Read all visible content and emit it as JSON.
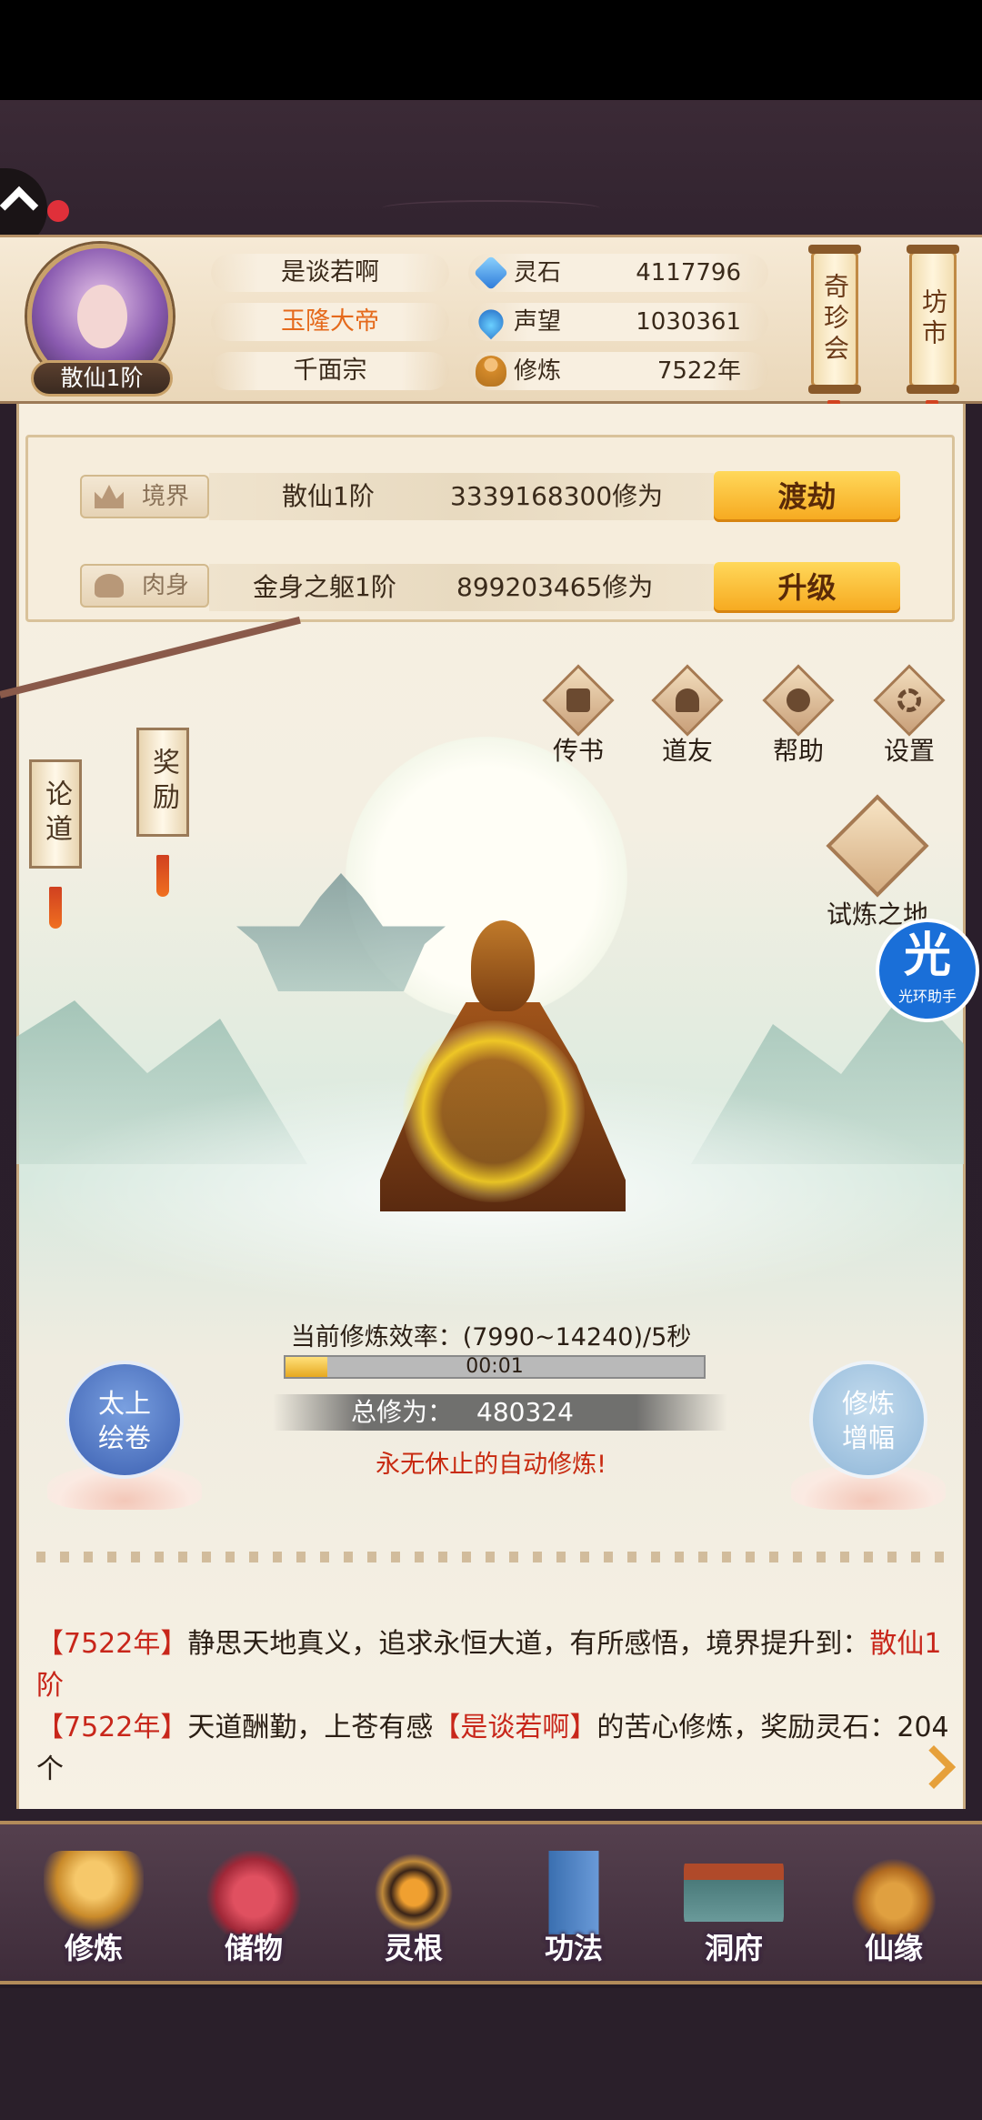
{
  "player": {
    "name": "是谈若啊",
    "title": "玉隆大帝",
    "sect": "千面宗",
    "rank": "散仙1阶"
  },
  "resources": [
    {
      "icon": "spirit-stone-icon",
      "label": "灵石",
      "value": "4117796"
    },
    {
      "icon": "reputation-icon",
      "label": "声望",
      "value": "1030361"
    },
    {
      "icon": "cultivation-icon",
      "label": "修炼",
      "value": "7522年"
    }
  ],
  "top_buttons": {
    "treasure": "奇珍会",
    "market": "坊市"
  },
  "realm": {
    "label": "境界",
    "stage": "散仙1阶",
    "required": "3339168300修为",
    "action": "渡劫"
  },
  "body": {
    "label": "肉身",
    "stage": "金身之躯1阶",
    "required": "899203465修为",
    "action": "升级"
  },
  "side_scrolls": {
    "discuss": "论道",
    "reward": "奖励"
  },
  "quick_icons": [
    {
      "icon": "mail-icon",
      "label": "传书"
    },
    {
      "icon": "friend-icon",
      "label": "道友"
    },
    {
      "icon": "help-icon",
      "label": "帮助"
    },
    {
      "icon": "settings-icon",
      "label": "设置"
    }
  ],
  "trial": {
    "label": "试炼之地"
  },
  "helper": {
    "big": "光",
    "small": "光环助手"
  },
  "cultivation": {
    "efficiency": "当前修炼效率：(7990~14240)/5秒",
    "timer": "00:01",
    "progress": 0.1,
    "total_label": "总修为：",
    "total_value": "480324",
    "auto_text": "永无休止的自动修炼!"
  },
  "left_round": {
    "line1": "太上",
    "line2": "绘卷"
  },
  "right_round": {
    "line1": "修炼",
    "line2": "增幅"
  },
  "log": {
    "l1_year": "7522年",
    "l1_text": "静思天地真义，追求永恒大道，有所感悟，境界提升到：",
    "l1_result": "散仙1阶",
    "l2_year": "7522年",
    "l2_text_a": "天道酬勤，上苍有感",
    "l2_name": "是谈若啊",
    "l2_text_b": "的苦心修炼，奖励灵石：",
    "l2_amount": "204个"
  },
  "nav": [
    {
      "icon": "cultivate-icon",
      "label": "修炼"
    },
    {
      "icon": "storage-bag-icon",
      "label": "储物"
    },
    {
      "icon": "spirit-root-icon",
      "label": "灵根"
    },
    {
      "icon": "technique-book-icon",
      "label": "功法"
    },
    {
      "icon": "cave-dwelling-icon",
      "label": "洞府"
    },
    {
      "icon": "fortune-gourd-icon",
      "label": "仙缘"
    }
  ],
  "colors": {
    "accent_gold": "#f6a81e",
    "text_red": "#c8261a",
    "title_orange": "#e56a1c"
  }
}
